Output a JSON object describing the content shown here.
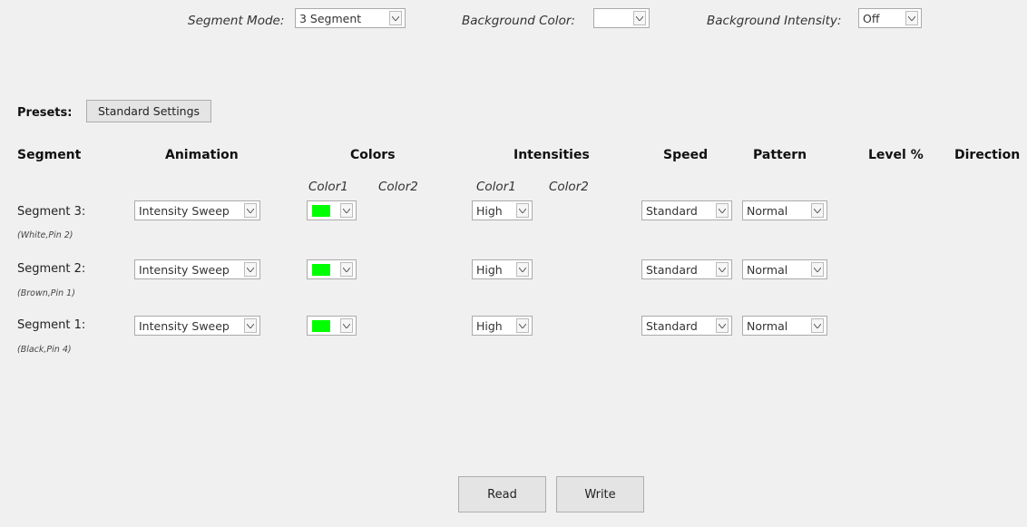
{
  "top": {
    "segment_mode_label": "Segment Mode:",
    "segment_mode_value": "3 Segment",
    "bg_color_label": "Background  Color:",
    "bg_color_value": "",
    "bg_intensity_label": "Background  Intensity:",
    "bg_intensity_value": "Off"
  },
  "presets": {
    "label": "Presets:",
    "button": "Standard Settings"
  },
  "headers": {
    "segment": "Segment",
    "animation": "Animation",
    "colors": "Colors",
    "intensities": "Intensities",
    "speed": "Speed",
    "pattern": "Pattern",
    "level": "Level %",
    "direction": "Direction"
  },
  "subheaders": {
    "colors_color1": "Color1",
    "colors_color2": "Color2",
    "int_color1": "Color1",
    "int_color2": "Color2"
  },
  "rows": [
    {
      "label": "Segment 3:",
      "sub": "(White,Pin 2)",
      "animation": "Intensity Sweep",
      "color1": "#00ff00",
      "intensity1": "High",
      "speed": "Standard",
      "pattern": "Normal"
    },
    {
      "label": "Segment 2:",
      "sub": "(Brown,Pin 1)",
      "animation": "Intensity Sweep",
      "color1": "#00ff00",
      "intensity1": "High",
      "speed": "Standard",
      "pattern": "Normal"
    },
    {
      "label": "Segment 1:",
      "sub": "(Black,Pin 4)",
      "animation": "Intensity Sweep",
      "color1": "#00ff00",
      "intensity1": "High",
      "speed": "Standard",
      "pattern": "Normal"
    }
  ],
  "buttons": {
    "read": "Read",
    "write": "Write"
  }
}
